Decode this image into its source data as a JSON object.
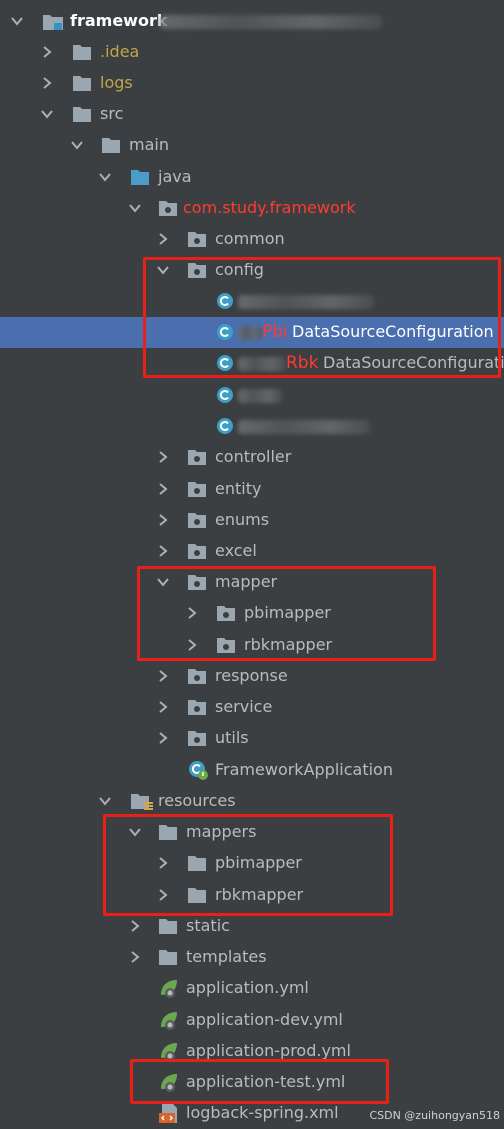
{
  "tree": {
    "project": "framework",
    "items": [
      {
        "label": ".idea"
      },
      {
        "label": "logs"
      },
      {
        "label": "src"
      },
      {
        "label": "main"
      },
      {
        "label": "java"
      },
      {
        "label": "com.study.framework"
      },
      {
        "label": "common"
      },
      {
        "label": "config"
      },
      {
        "label": ""
      },
      {
        "prefix": "Pbi",
        "label": "DataSourceConfiguration"
      },
      {
        "prefix": "Rbk",
        "label": "DataSourceConfigurati"
      },
      {
        "label": ""
      },
      {
        "label": ""
      },
      {
        "label": "controller"
      },
      {
        "label": "entity"
      },
      {
        "label": "enums"
      },
      {
        "label": "excel"
      },
      {
        "label": "mapper"
      },
      {
        "label": "pbimapper"
      },
      {
        "label": "rbkmapper"
      },
      {
        "label": "response"
      },
      {
        "label": "service"
      },
      {
        "label": "utils"
      },
      {
        "label": "FrameworkApplication"
      },
      {
        "label": "resources"
      },
      {
        "label": "mappers"
      },
      {
        "label": "pbimapper"
      },
      {
        "label": "rbkmapper"
      },
      {
        "label": "static"
      },
      {
        "label": "templates"
      },
      {
        "label": "application.yml"
      },
      {
        "label": "application-dev.yml"
      },
      {
        "label": "application-prod.yml"
      },
      {
        "label": "application-test.yml"
      },
      {
        "label": "logback-spring.xml"
      }
    ]
  },
  "colors": {
    "background": "#3c3f41",
    "selection": "#4b6eaf",
    "folder": "#9aa7b0",
    "source_folder": "#4a9cc9",
    "class_icon": "#3c9fc4",
    "spring_leaf": "#6aa84f",
    "annotation_red": "#e8201a",
    "excluded_text": "#c0a64b"
  },
  "icons": {
    "expanded": "chevron-down-icon",
    "collapsed": "chevron-right-icon",
    "folder": "folder-icon",
    "package": "package-icon",
    "class": "class-icon",
    "spring_boot": "spring-boot-icon",
    "yaml": "spring-yaml-icon",
    "xml": "xml-icon"
  },
  "watermark": "CSDN @zuihongyan518"
}
